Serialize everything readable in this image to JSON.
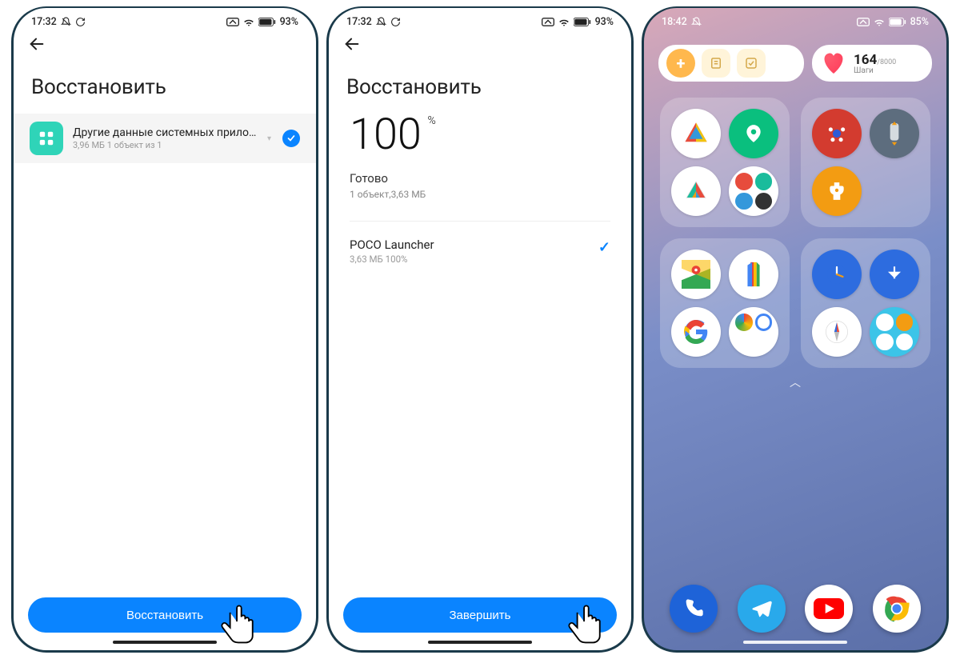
{
  "screen1": {
    "status": {
      "time": "17:32",
      "battery": "93%"
    },
    "title": "Восстановить",
    "item": {
      "title": "Другие данные системных прило…",
      "sub": "3,96 МБ  1 объект из 1"
    },
    "button": "Восстановить"
  },
  "screen2": {
    "status": {
      "time": "17:32",
      "battery": "93%"
    },
    "title": "Восстановить",
    "percent": "100",
    "percent_sym": "%",
    "done": "Готово",
    "done_sub": "1 объект,3,63 МБ",
    "result": {
      "title": "POCO Launcher",
      "sub": "3,63 МБ 100%"
    },
    "button": "Завершить"
  },
  "screen3": {
    "status": {
      "time": "18:42",
      "battery": "85%"
    },
    "steps": {
      "value": "164",
      "max": "/8000",
      "label": "Шаги"
    },
    "hint": "︿"
  }
}
